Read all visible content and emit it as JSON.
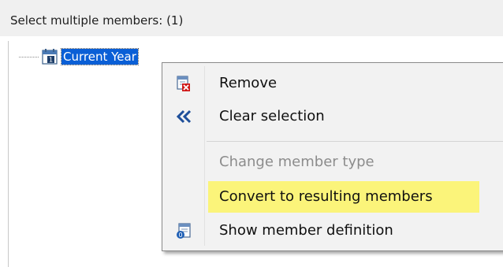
{
  "header": {
    "title": "Select multiple members: (1)"
  },
  "tree": {
    "node_label": "Current Year",
    "node_icon": "calendar-member-icon"
  },
  "context_menu": {
    "items": [
      {
        "label": "Remove",
        "icon": "remove-member-icon",
        "enabled": true
      },
      {
        "label": "Clear selection",
        "icon": "double-chevron-left-icon",
        "enabled": true
      },
      {
        "label": "Change member type",
        "icon": "",
        "enabled": false
      },
      {
        "label": "Convert to resulting members",
        "icon": "",
        "enabled": true,
        "highlighted": true
      },
      {
        "label": "Show member definition",
        "icon": "member-definition-icon",
        "enabled": true
      }
    ]
  },
  "colors": {
    "selection": "#0a5fd6",
    "highlight": "#fbf47a",
    "menu_background": "#f2f2f2",
    "disabled_text": "#8c8c8c"
  }
}
